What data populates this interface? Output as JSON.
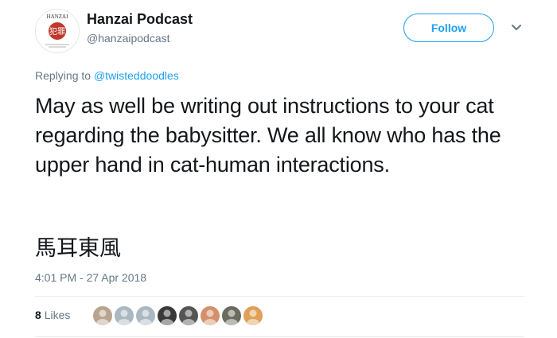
{
  "user": {
    "name": "Hanzai Podcast",
    "handle": "@hanzaipodcast",
    "avatar_text": "HANZAI",
    "avatar_kanji": "犯罪"
  },
  "actions": {
    "follow_label": "Follow",
    "menu_icon": "chevron-down-icon"
  },
  "reply": {
    "prefix": "Replying to",
    "target": "@twisteddoodles"
  },
  "tweet": {
    "text": "May as well be writing out instructions to your cat regarding the babysitter. We all know who has the upper hand in cat-human interactions.",
    "kanji": "馬耳東風",
    "timestamp": "4:01 PM - 27 Apr 2018"
  },
  "stats": {
    "likes_count": "8",
    "likes_label": "Likes",
    "likers": [
      {
        "color": "#b9a48e"
      },
      {
        "color": "#aab8c2"
      },
      {
        "color": "#aab8c2"
      },
      {
        "color": "#3a3a3a"
      },
      {
        "color": "#555555"
      },
      {
        "color": "#d4906a"
      },
      {
        "color": "#6b6b5e"
      },
      {
        "color": "#e0a058"
      }
    ]
  },
  "colors": {
    "accent": "#1da1f2",
    "muted": "#657786",
    "text": "#14171a"
  }
}
